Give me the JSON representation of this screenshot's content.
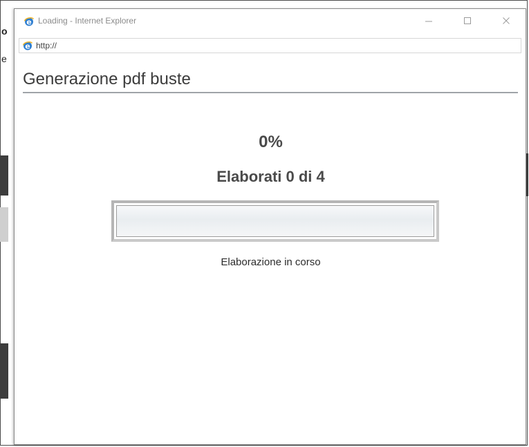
{
  "window": {
    "title": "Loading - Internet Explorer",
    "address": "http://"
  },
  "background_fragments": {
    "letter_top": "o",
    "letter_mid": "e"
  },
  "page": {
    "title": "Generazione pdf buste"
  },
  "progress": {
    "percent_label": "0%",
    "percent_value": 0,
    "counter_label": "Elaborati 0 di 4",
    "processed": 0,
    "total": 4,
    "status_text": "Elaborazione in corso"
  },
  "icons": {
    "app": "internet-explorer-icon",
    "address": "internet-explorer-icon",
    "minimize": "minimize-icon",
    "maximize": "maximize-icon",
    "close": "close-icon"
  },
  "colors": {
    "ie_blue": "#2f7fd1",
    "ie_ring": "#f0b429",
    "title_rule": "#9fa4a8",
    "heading_text": "#4a4a4a",
    "progress_fill": "#4a90d9"
  }
}
